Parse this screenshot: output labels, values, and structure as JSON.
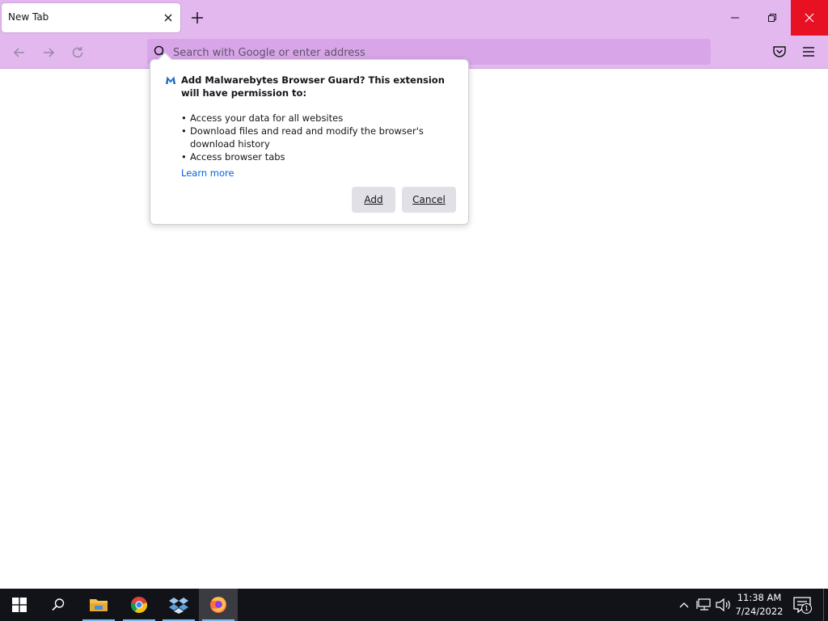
{
  "browser": {
    "tab_title": "New Tab",
    "url_placeholder": "Search with Google or enter address",
    "theme_color": "#e3b8ef"
  },
  "popup": {
    "heading": "Add Malwarebytes Browser Guard? This extension will have permission to:",
    "permissions": [
      "Access your data for all websites",
      "Download files and read and modify the browser's download history",
      "Access browser tabs"
    ],
    "bullet": "•",
    "learn_more": "Learn more",
    "add_label": "Add",
    "cancel_label": "Cancel",
    "icon": "malwarebytes-icon"
  },
  "taskbar": {
    "time": "11:38 AM",
    "date": "7/24/2022",
    "notification_count": "1",
    "apps": [
      "start-icon",
      "search-icon",
      "file-explorer-icon",
      "chrome-icon",
      "dropbox-icon",
      "firefox-icon"
    ]
  },
  "colors": {
    "close_button": "#e81123",
    "link": "#0060df",
    "taskbar": "#111318"
  }
}
